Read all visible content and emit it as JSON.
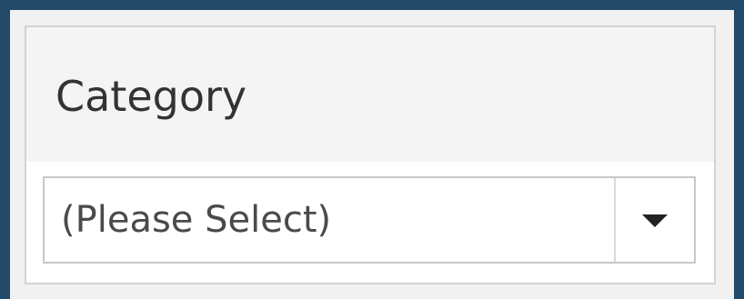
{
  "filter": {
    "title": "Category",
    "selected_value": "(Please Select)",
    "dropdown_icon": "triangle-down-icon"
  },
  "colors": {
    "background": "#244a6a",
    "panel_header": "#f4f4f4",
    "panel_border": "#d3d3d3",
    "text": "#333333"
  }
}
